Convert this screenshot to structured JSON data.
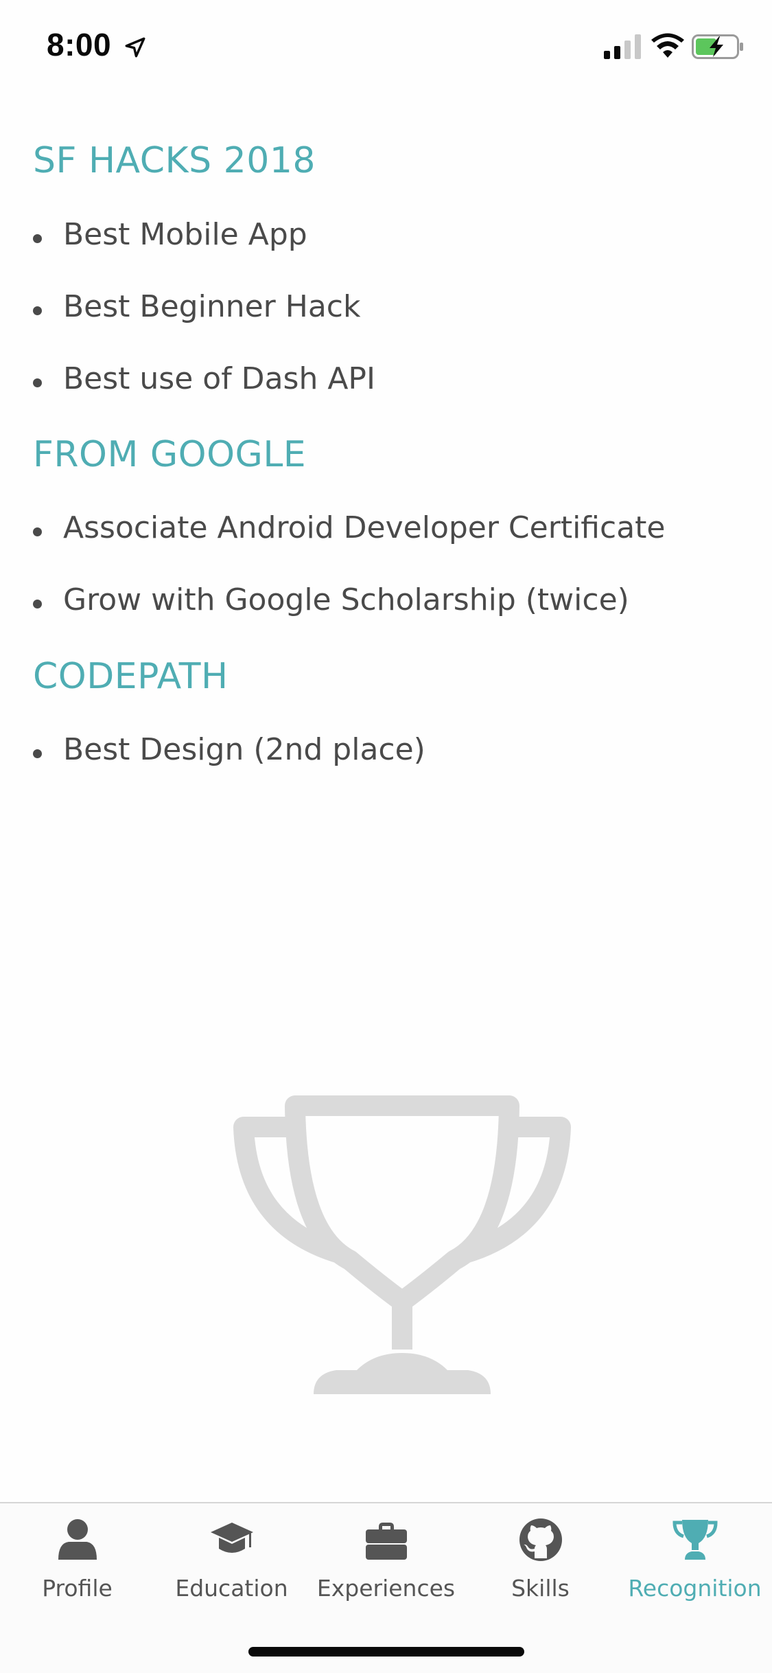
{
  "status_bar": {
    "time": "8:00"
  },
  "sections": [
    {
      "title": "SF HACKS 2018",
      "items": [
        "Best Mobile App",
        "Best Beginner Hack",
        "Best use of Dash API"
      ]
    },
    {
      "title": "FROM GOOGLE",
      "items": [
        "Associate Android Developer Certificate",
        "Grow with Google Scholarship (twice)"
      ]
    },
    {
      "title": "CODEPATH",
      "items": [
        "Best Design (2nd place)"
      ]
    }
  ],
  "tab_bar": {
    "tabs": [
      {
        "label": "Profile",
        "icon": "person-icon",
        "active": false
      },
      {
        "label": "Education",
        "icon": "graduation-cap-icon",
        "active": false
      },
      {
        "label": "Experiences",
        "icon": "briefcase-icon",
        "active": false
      },
      {
        "label": "Skills",
        "icon": "github-icon",
        "active": false
      },
      {
        "label": "Recognition",
        "icon": "trophy-icon",
        "active": true
      }
    ]
  },
  "colors": {
    "accent": "#4fadb3",
    "text": "#4a4a4a",
    "tab_inactive": "#555555",
    "trophy_placeholder": "#dadada"
  }
}
